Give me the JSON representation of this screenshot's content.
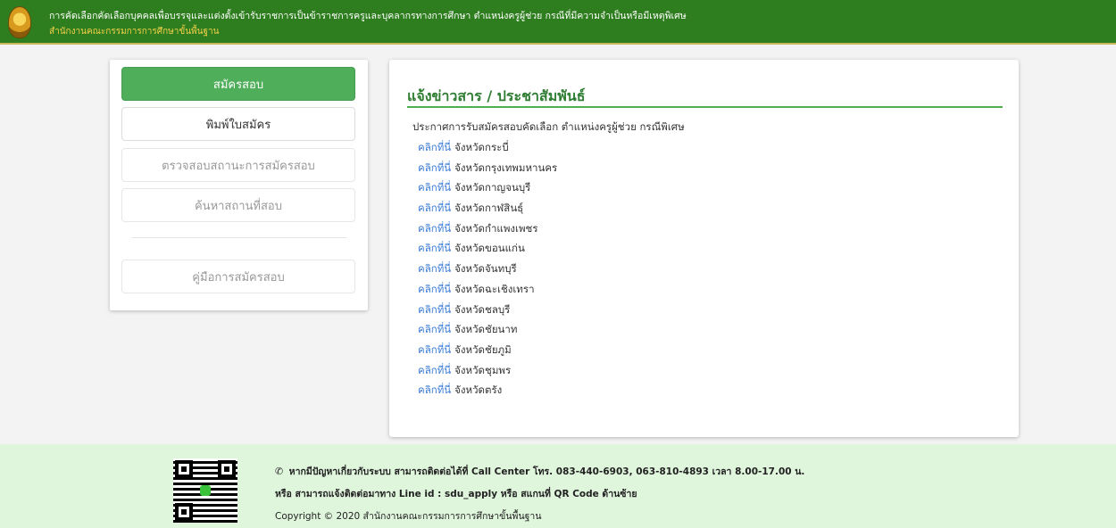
{
  "header": {
    "title": "การคัดเลือกคัดเลือกบุคคลเพื่อบรรจุและแต่งตั้งเข้ารับราชการเป็นข้าราชการครูและบุคลากรทางการศึกษา ตำแหน่งครูผู้ช่วย กรณีที่มีความจำเป็นหรือมีเหตุพิเศษ",
    "subtitle": "สำนักงานคณะกรรมการการศึกษาขั้นพื้นฐาน",
    "logo_icon": "seal-logo",
    "bg_color": "#2e7d1e",
    "subtitle_color": "#f2d04a"
  },
  "menu": {
    "items": [
      {
        "label": "สมัครสอบ",
        "style": "primary"
      },
      {
        "label": "พิมพ์ใบสมัคร",
        "style": "default"
      },
      {
        "label": "ตรวจสอบสถานะการสมัครสอบ",
        "style": "muted"
      },
      {
        "label": "ค้นหาสถานที่สอบ",
        "style": "muted"
      },
      {
        "label": "คู่มือการสมัครสอบ",
        "style": "muted"
      }
    ],
    "primary_color": "#4fae5a"
  },
  "news": {
    "title": "แจ้งข่าวสาร / ประชาสัมพันธ์",
    "intro": "ประกาศการรับสมัครสอบคัดเลือก ตำแหน่งครูผู้ช่วย กรณีพิเศษ",
    "link_label": "คลิกที่นี่",
    "provinces": [
      "จังหวัดกระบี่",
      "จังหวัดกรุงเทพมหานคร",
      "จังหวัดกาญจนบุรี",
      "จังหวัดกาฬสินธุ์",
      "จังหวัดกำแพงเพชร",
      "จังหวัดขอนแก่น",
      "จังหวัดจันทบุรี",
      "จังหวัดฉะเชิงเทรา",
      "จังหวัดชลบุรี",
      "จังหวัดชัยนาท",
      "จังหวัดชัยภูมิ",
      "จังหวัดชุมพร",
      "จังหวัดตรัง"
    ],
    "link_color": "#3a7bd5",
    "title_color": "#2e7d32"
  },
  "footer": {
    "contact": "หากมีปัญหาเกี่ยวกับระบบ สามารถติดต่อได้ที่ Call Center โทร. 083-440-6903, 063-810-4893 เวลา 8.00-17.00 น.",
    "line": "หรือ สามารถแจ้งติดต่อมาทาง Line id : sdu_apply หรือ สแกนที่ QR Code ด้านซ้าย",
    "copyright": "Copyright © 2020 สำนักงานคณะกรรมการการศึกษาขั้นพื้นฐาน",
    "phone_icon": "phone-icon",
    "qr_icon": "line-qr-code",
    "bg_color": "#dff5dc"
  }
}
